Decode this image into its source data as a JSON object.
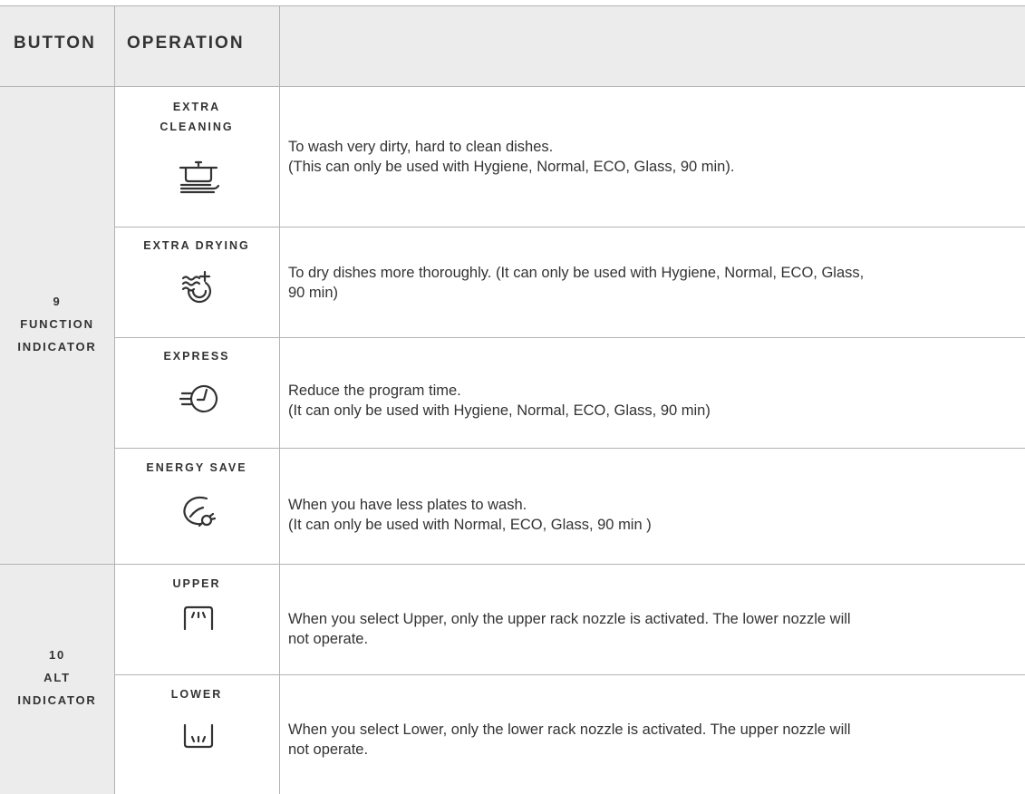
{
  "header": {
    "button": "BUTTON",
    "operation": "OPERATION",
    "blank": ""
  },
  "groups": [
    {
      "number": "9",
      "line1": "FUNCTION",
      "line2": "INDICATOR"
    },
    {
      "number": "10",
      "line1": "ALT",
      "line2": "INDICATOR"
    }
  ],
  "rows": [
    {
      "label_line1": "EXTRA",
      "label_line2": "CLEANING",
      "icon": "pot-on-heat-icon",
      "desc_line1": "To wash very dirty, hard to clean dishes.",
      "desc_line2": "(This can only be used with Hygiene, Normal, ECO, Glass, 90 min)."
    },
    {
      "label_line1": "EXTRA DRYING",
      "icon": "extra-drying-icon",
      "desc_line1": "To dry dishes more thoroughly. (It can only be used with Hygiene, Normal, ECO, Glass,",
      "desc_line2": "90 min)"
    },
    {
      "label_line1": "EXPRESS",
      "icon": "express-clock-icon",
      "desc_line1": "Reduce the program time.",
      "desc_line2": "(It can only be used with Hygiene, Normal, ECO, Glass, 90 min)"
    },
    {
      "label_line1": "ENERGY SAVE",
      "icon": "leaf-plug-icon",
      "desc_line1": "When you have less plates to wash.",
      "desc_line2": "(It can only be used with Normal, ECO, Glass, 90 min )"
    },
    {
      "label_line1": "UPPER",
      "icon": "upper-rack-icon",
      "desc_line1": "When you select Upper, only the upper rack nozzle is activated. The lower nozzle will",
      "desc_line2": "not operate."
    },
    {
      "label_line1": "LOWER",
      "icon": "lower-rack-icon",
      "desc_line1": "When you select Lower, only the lower rack nozzle is activated. The upper nozzle will",
      "desc_line2": "not operate."
    }
  ]
}
